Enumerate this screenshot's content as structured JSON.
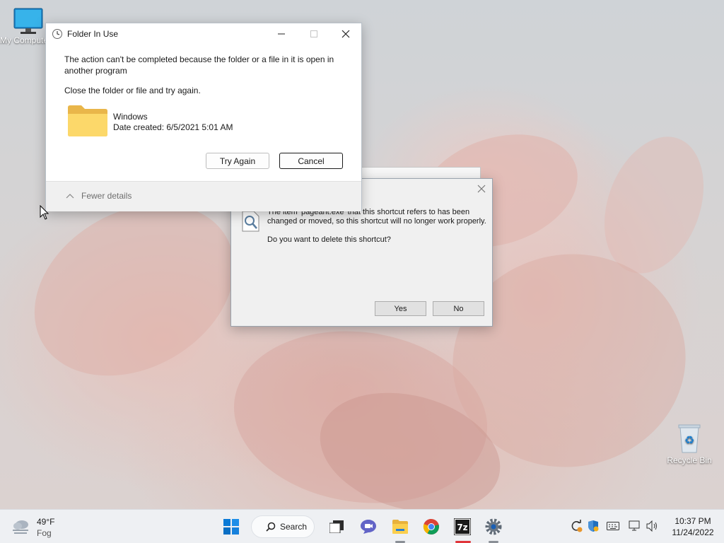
{
  "desktop": {
    "my_computer_label": "My Computer",
    "recycle_bin_label": "Recycle Bin"
  },
  "folder_dialog": {
    "title": "Folder In Use",
    "message": "The action can't be completed because the folder or a file in it is open in another program",
    "instruction": "Close the folder or file and try again.",
    "item_name": "Windows",
    "item_date": "Date created: 6/5/2021 5:01 AM",
    "try_again_label": "Try Again",
    "cancel_label": "Cancel",
    "details_label": "Fewer details"
  },
  "shortcut_dialog": {
    "message_line1": "The item 'pageant.exe' that this shortcut refers to has been",
    "message_line2": "changed or moved, so this shortcut will no longer work properly.",
    "question": "Do you want to delete this shortcut?",
    "yes_label": "Yes",
    "no_label": "No"
  },
  "taskbar": {
    "weather_temp": "49°F",
    "weather_cond": "Fog",
    "search_label": "Search",
    "time": "10:37 PM",
    "date": "11/24/2022",
    "icons": [
      "start-icon",
      "search-icon",
      "task-view-icon",
      "chat-icon",
      "file-explorer-icon",
      "chrome-icon",
      "7zip-icon",
      "settings-icon"
    ]
  },
  "colors": {
    "accent": "#0067c0",
    "dialog_bg": "#f0f0f0",
    "taskbar_bg": "#eef0f3"
  }
}
